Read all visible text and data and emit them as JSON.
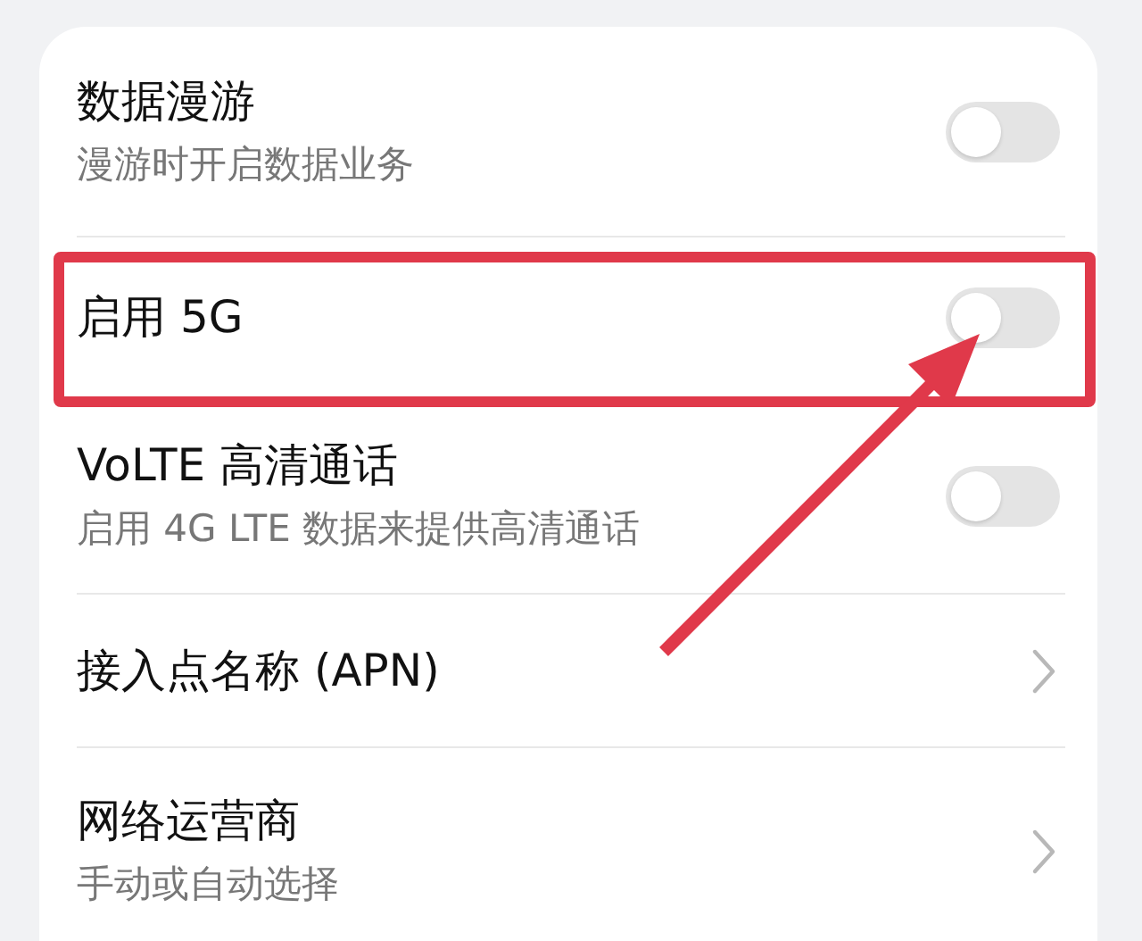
{
  "settings": [
    {
      "kind": "toggle",
      "title": "数据漫游",
      "subtitle": "漫游时开启数据业务",
      "on": false,
      "highlighted": false
    },
    {
      "kind": "toggle",
      "title": "启用 5G",
      "on": false,
      "highlighted": true
    },
    {
      "kind": "toggle",
      "title": "VoLTE 高清通话",
      "subtitle": "启用 4G LTE 数据来提供高清通话",
      "on": false,
      "highlighted": false
    },
    {
      "kind": "link",
      "title": "接入点名称 (APN)",
      "highlighted": false
    },
    {
      "kind": "link",
      "title": "网络运营商",
      "subtitle": "手动或自动选择",
      "highlighted": false
    }
  ]
}
